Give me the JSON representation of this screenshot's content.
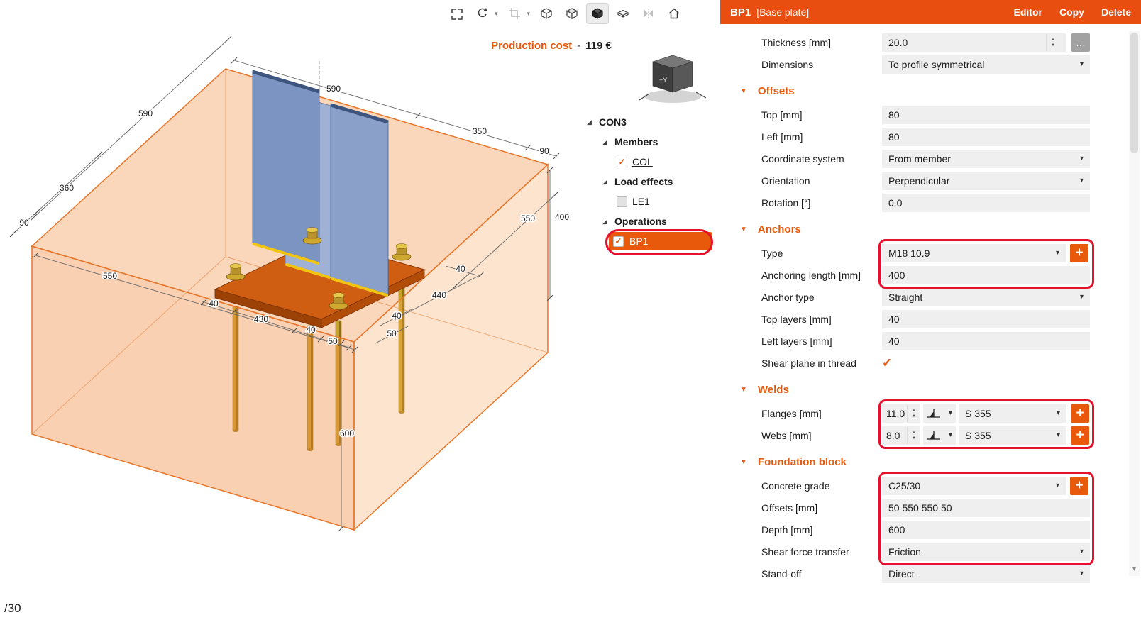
{
  "app": {
    "bottom_corner_text": "/30"
  },
  "icons": {
    "chevron_down": "▾",
    "spinner_up": "▲",
    "spinner_down": "▼",
    "section_caret": "▼",
    "tree_caret": "◢",
    "check": "✓",
    "plus": "+",
    "more": "…",
    "scroll_down": "▾"
  },
  "toolbar": {
    "icons": [
      "fit-view",
      "rotate-view",
      "section-view",
      "cube-wireframe",
      "cube-hidden-lines",
      "cube-solid",
      "plate-view",
      "mirror-view",
      "home-view"
    ],
    "selected_icon": "cube-solid"
  },
  "viewport": {
    "production_cost_label": "Production cost",
    "production_cost_separator": "-",
    "production_cost_value": "119 €",
    "nav_cube_label": "+Y"
  },
  "tree": {
    "root_label": "CON3",
    "members_label": "Members",
    "col_label": "COL",
    "load_effects_label": "Load effects",
    "le1_label": "LE1",
    "operations_label": "Operations",
    "bp1_label": "BP1"
  },
  "panel": {
    "title": "BP1",
    "subtitle": "[Base plate]",
    "editor_label": "Editor",
    "copy_label": "Copy",
    "delete_label": "Delete"
  },
  "properties": {
    "thickness": {
      "label": "Thickness [mm]",
      "value": "20.0"
    },
    "dimensions": {
      "label": "Dimensions",
      "value": "To profile symmetrical"
    },
    "offsets_section": "Offsets",
    "top": {
      "label": "Top [mm]",
      "value": "80"
    },
    "left": {
      "label": "Left [mm]",
      "value": "80"
    },
    "coordinate_system": {
      "label": "Coordinate system",
      "value": "From member"
    },
    "orientation": {
      "label": "Orientation",
      "value": "Perpendicular"
    },
    "rotation": {
      "label": "Rotation [°]",
      "value": "0.0"
    },
    "anchors_section": "Anchors",
    "type": {
      "label": "Type",
      "value": "M18 10.9"
    },
    "anchoring_length": {
      "label": "Anchoring length [mm]",
      "value": "400"
    },
    "anchor_type": {
      "label": "Anchor type",
      "value": "Straight"
    },
    "top_layers": {
      "label": "Top layers [mm]",
      "value": "40"
    },
    "left_layers": {
      "label": "Left layers [mm]",
      "value": "40"
    },
    "shear_plane": {
      "label": "Shear plane in thread",
      "checked": true
    },
    "welds_section": "Welds",
    "flanges": {
      "label": "Flanges [mm]",
      "value": "11.0",
      "material": "S 355"
    },
    "webs": {
      "label": "Webs [mm]",
      "value": "8.0",
      "material": "S 355"
    },
    "foundation_section": "Foundation block",
    "concrete_grade": {
      "label": "Concrete grade",
      "value": "C25/30"
    },
    "block_offsets": {
      "label": "Offsets [mm]",
      "value": "50 550 550 50"
    },
    "depth": {
      "label": "Depth [mm]",
      "value": "600"
    },
    "shear_force_transfer": {
      "label": "Shear force transfer",
      "value": "Friction"
    },
    "stand_off": {
      "label": "Stand-off",
      "value": "Direct"
    }
  },
  "scene": {
    "dims": {
      "top_left_590": "590",
      "top_590": "590",
      "top_350": "350",
      "top_90": "90",
      "left_360": "360",
      "left_90": "90",
      "left_550": "550",
      "right_550": "550",
      "right_400": "400",
      "plate_40_right": "40",
      "plate_440": "440",
      "plate_40_left": "40",
      "plate_430": "430",
      "plate_40_mid": "40",
      "plate_50_front": "50",
      "plate_40_fr": "40",
      "plate_50_fr": "50",
      "depth_600": "600"
    }
  }
}
